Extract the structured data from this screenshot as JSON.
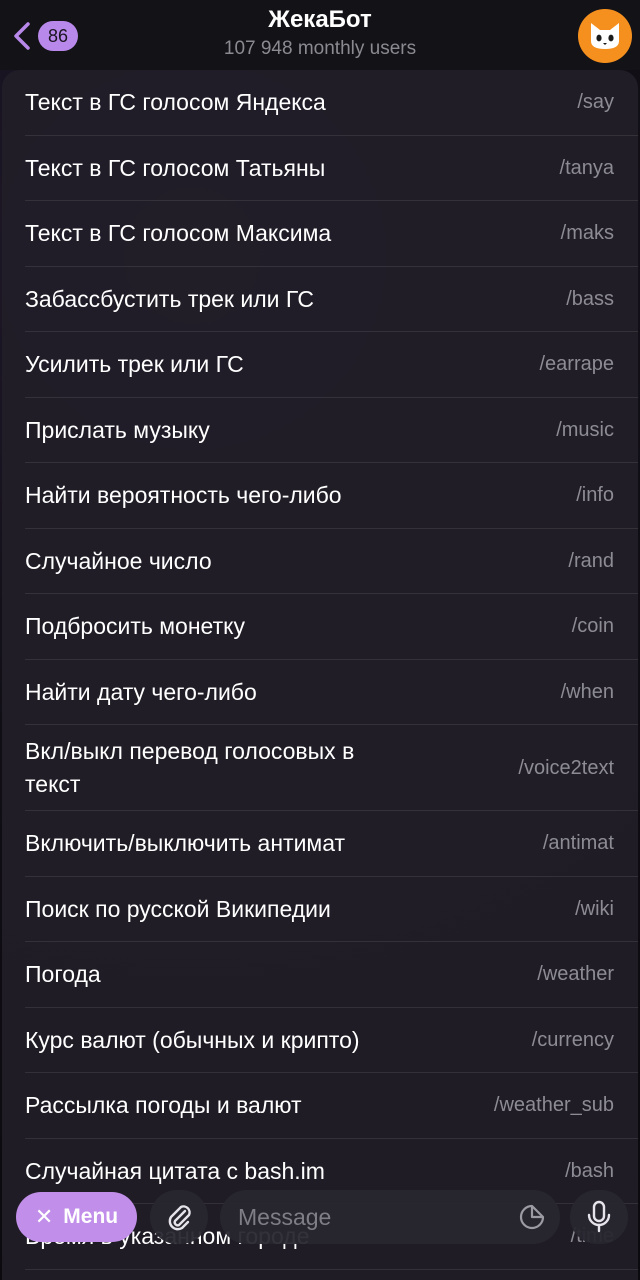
{
  "header": {
    "back_badge": "86",
    "title": "ЖекаБот",
    "subtitle": "107 948 monthly users"
  },
  "commands": [
    {
      "description": "Текст в ГС голосом Яндекса",
      "command": "/say"
    },
    {
      "description": "Текст в ГС голосом Татьяны",
      "command": "/tanya"
    },
    {
      "description": "Текст в ГС голосом Максима",
      "command": "/maks"
    },
    {
      "description": "Забассбустить трек или ГС",
      "command": "/bass"
    },
    {
      "description": "Усилить трек или ГС",
      "command": "/earrape"
    },
    {
      "description": "Прислать музыку",
      "command": "/music"
    },
    {
      "description": "Найти вероятность чего-либо",
      "command": "/info"
    },
    {
      "description": "Случайное число",
      "command": "/rand"
    },
    {
      "description": "Подбросить монетку",
      "command": "/coin"
    },
    {
      "description": "Найти дату чего-либо",
      "command": "/when"
    },
    {
      "description": "Вкл/выкл перевод голосовых в текст",
      "command": "/voice2text"
    },
    {
      "description": "Включить/выключить антимат",
      "command": "/antimat"
    },
    {
      "description": "Поиск по русской Википедии",
      "command": "/wiki"
    },
    {
      "description": "Погода",
      "command": "/weather"
    },
    {
      "description": "Курс валют (обычных и крипто)",
      "command": "/currency"
    },
    {
      "description": "Рассылка погоды и валют",
      "command": "/weather_sub"
    },
    {
      "description": "Случайная цитата с bash.im",
      "command": "/bash"
    },
    {
      "description": "Время в указанном городе",
      "command": "/time"
    }
  ],
  "input_bar": {
    "menu_label": "Menu",
    "menu_icon": "close-icon",
    "placeholder": "Message",
    "attach_icon": "paperclip-icon",
    "sticker_icon": "sticker-icon",
    "mic_icon": "microphone-icon"
  },
  "colors": {
    "accent": "#b889ea",
    "avatar": "#f5901f",
    "menu_button": "#c18ee9"
  }
}
